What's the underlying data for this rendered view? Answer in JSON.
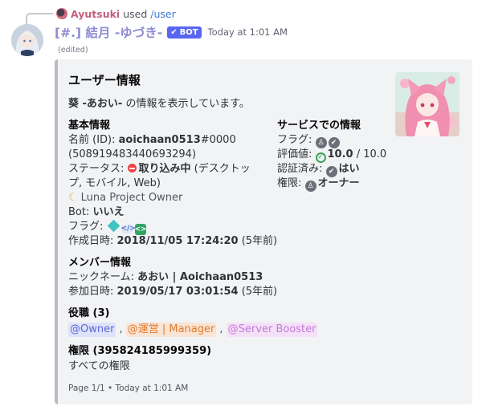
{
  "reply": {
    "username": "Ayutsuki",
    "used_text": "used",
    "command": "/user"
  },
  "message": {
    "author": "[#.] 結月 -ゆづき-",
    "bot_tag": "BOT",
    "timestamp": "Today at 1:01 AM",
    "edited": "(edited)"
  },
  "embed": {
    "title": "ユーザー情報",
    "description_name": "葵 -あおい-",
    "description_rest": " の情報を表示しています。",
    "basic": {
      "title": "基本情報",
      "name_label": "名前 (ID): ",
      "name_value": "aoichaan0513",
      "discriminator": "#0000",
      "id": "(508919483440693294)",
      "status_label": "ステータス: ",
      "status_value": "取り込み中",
      "status_devices_1": " (デスクトッ",
      "status_devices_2": "プ, モバイル, Web)",
      "custom_status": "Luna Project Owner",
      "bot_label": "Bot: ",
      "bot_value": "いいえ",
      "flags_label": "フラグ: ",
      "created_label": "作成日時: ",
      "created_value": "2018/11/05 17:24:20",
      "created_ago": " (5年前)"
    },
    "service": {
      "title": "サービスでの情報",
      "flags_label": "フラグ: ",
      "rating_label": "評価値: ",
      "rating_value": "10.0",
      "rating_max": " / 10.0",
      "verified_label": "認証済み: ",
      "verified_value": "はい",
      "permission_label": "権限: ",
      "permission_value": "オーナー"
    },
    "member": {
      "title": "メンバー情報",
      "nickname_label": "ニックネーム: ",
      "nickname_value": "あおい | Aoichaan0513",
      "joined_label": "参加日時: ",
      "joined_value": "2019/05/17 03:01:54",
      "joined_ago": " (5年前)"
    },
    "roles": {
      "title": "役職 (3)",
      "items": [
        "@Owner",
        "@運営 | Manager",
        "@Server Booster"
      ],
      "separator": ","
    },
    "permissions": {
      "title": "権限 (395824185999359)",
      "value": "すべての権限"
    },
    "footer": "Page 1/1 • Today at 1:01 AM"
  },
  "colors": {
    "blurple": "#5865f2",
    "dnd_red": "#ed4245",
    "online_green": "#3ba55c"
  },
  "icons": {
    "flag_badge_1": "hypesquad-balance-icon",
    "flag_badge_2": "active-developer-icon",
    "flag_badge_3": "early-verified-developer-icon"
  }
}
